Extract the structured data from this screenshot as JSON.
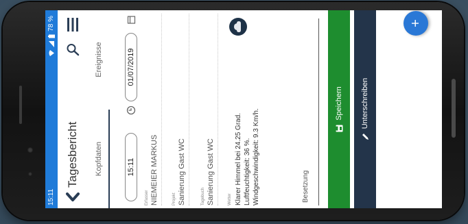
{
  "status_bar": {
    "time": "15:11",
    "battery": "78 %"
  },
  "header": {
    "title": "Tagesbericht"
  },
  "tabs": [
    {
      "label": "Kopfdaten"
    },
    {
      "label": "Ereignisse"
    }
  ],
  "header_fields": {
    "time_value": "15:11",
    "date_value": "01/07/2019"
  },
  "fields": {
    "erfasser": {
      "label": "Erfasser",
      "value": "NIEMEIER MARKUS"
    },
    "projekt": {
      "label": "Projekt",
      "value": "Sanierung Gast WC"
    },
    "tagebuch": {
      "label": "Tagebuch",
      "value": "Sanierung Gast WC"
    },
    "wetter": {
      "label": "Wetter",
      "lines": [
        "Klarer Himmel bei 24.25 Grad.",
        "Luftfeuchtigkeit: 36 %.",
        "Windgeschwindigkeit: 9.3 Km/h."
      ]
    },
    "besetzung": {
      "label": "Besetzung"
    }
  },
  "buttons": {
    "save": "Speichern",
    "sign": "Unterschreiben",
    "fab": "+"
  },
  "colors": {
    "status_bar": "#1f7bd9",
    "save_button": "#1e8d2f",
    "sign_button": "#23344a",
    "fab": "#2a78d6",
    "tab_indicator": "#2a3d55"
  }
}
